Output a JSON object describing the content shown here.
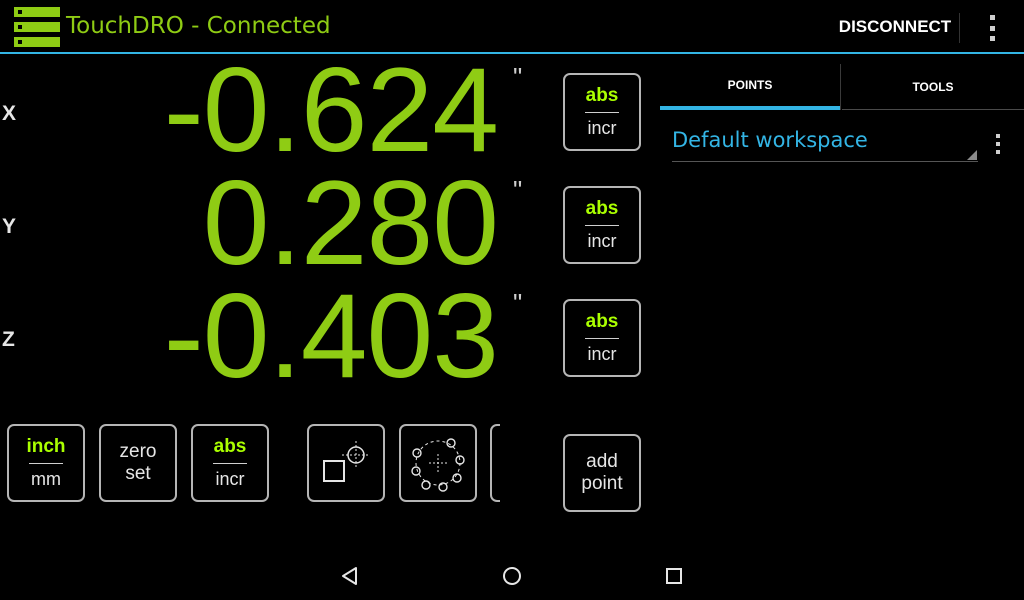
{
  "app": {
    "title": "TouchDRO - Connected",
    "accent_color": "#8fcc14",
    "highlight_color": "#33b5e5"
  },
  "action_bar": {
    "disconnect_label": "DISCONNECT",
    "overflow_icon": "overflow-menu-icon"
  },
  "axes": [
    {
      "label": "X",
      "value": "-0.624",
      "unit": "\"",
      "mode_top": "abs",
      "mode_bottom": "incr"
    },
    {
      "label": "Y",
      "value": "0.280",
      "unit": "\"",
      "mode_top": "abs",
      "mode_bottom": "incr"
    },
    {
      "label": "Z",
      "value": "-0.403",
      "unit": "\"",
      "mode_top": "abs",
      "mode_bottom": "incr"
    }
  ],
  "toolbar": {
    "units_top": "inch",
    "units_bottom": "mm",
    "zero_set_line1": "zero",
    "zero_set_line2": "set",
    "mode_top": "abs",
    "mode_bottom": "incr",
    "add_point_line1": "add",
    "add_point_line2": "point"
  },
  "panel": {
    "tabs": [
      {
        "label": "POINTS",
        "selected": true
      },
      {
        "label": "TOOLS",
        "selected": false
      }
    ],
    "workspace": "Default workspace"
  },
  "nav": {
    "back_icon": "back-icon",
    "home_icon": "home-icon",
    "recents_icon": "recents-icon"
  }
}
